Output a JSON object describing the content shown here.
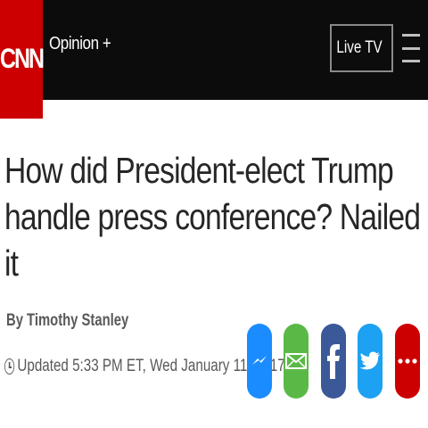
{
  "brand": {
    "logo_text": "CNN",
    "logo_color": "#cc0000"
  },
  "nav": {
    "section_label": "Opinion +",
    "live_tv_label": "Live TV"
  },
  "article": {
    "headline": "How did President-elect Trump handle press conference? Nailed it",
    "byline": "By Timothy Stanley",
    "timestamp": "Updated 5:33 PM ET, Wed January 11, 2017"
  },
  "share_buttons": [
    {
      "icon": "messenger-icon",
      "color": "#1a8cff"
    },
    {
      "icon": "email-icon",
      "color": "#5ab946"
    },
    {
      "icon": "facebook-icon",
      "color": "#3b5998"
    },
    {
      "icon": "twitter-icon",
      "color": "#1da1f2"
    },
    {
      "icon": "more-icon",
      "color": "#cc0000"
    }
  ]
}
